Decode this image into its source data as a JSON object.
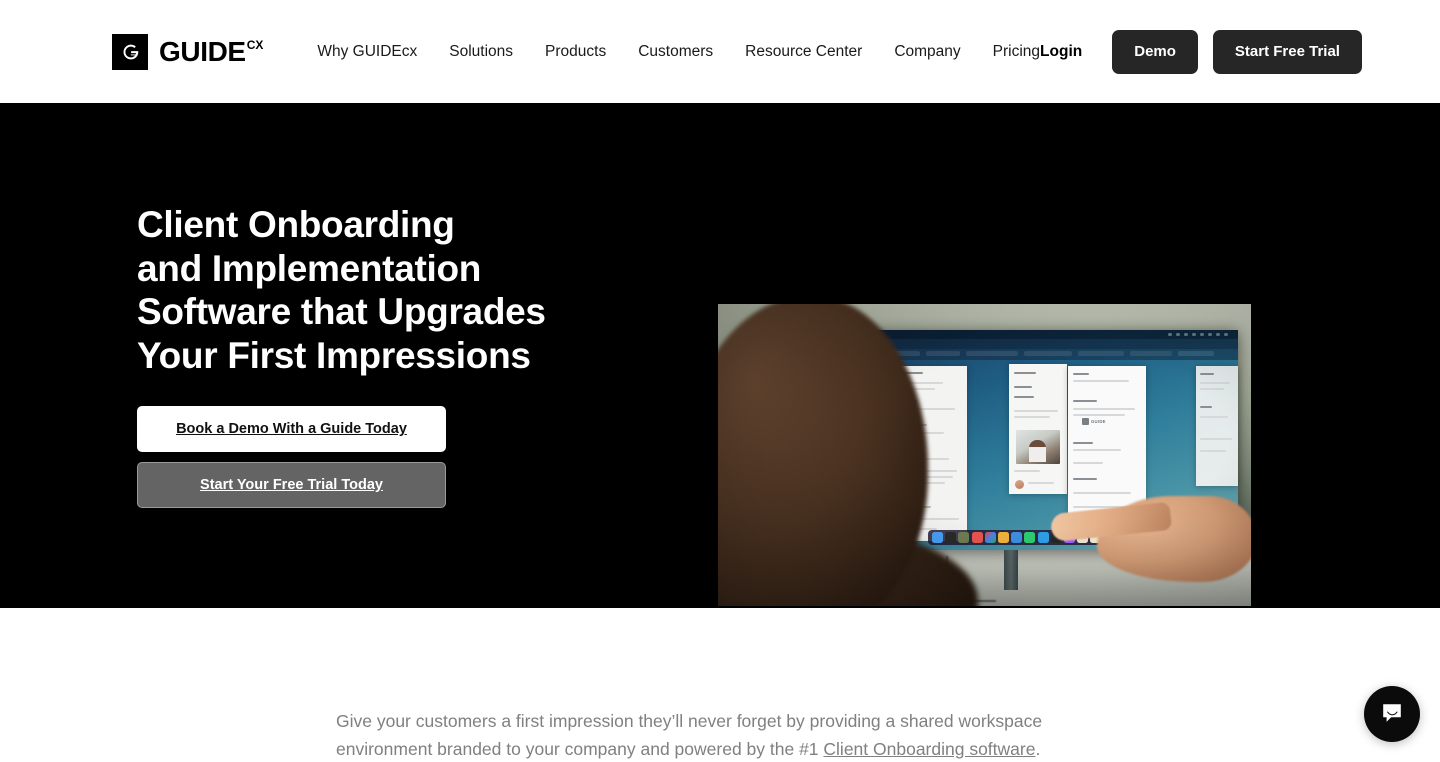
{
  "header": {
    "brand": {
      "mark_icon": "guidecx-g-logo-icon",
      "word": "GUIDE",
      "superscript": "CX"
    },
    "nav_items": [
      {
        "label": "Why GUIDEcx"
      },
      {
        "label": "Solutions"
      },
      {
        "label": "Products"
      },
      {
        "label": "Customers"
      },
      {
        "label": "Resource Center"
      },
      {
        "label": "Company"
      },
      {
        "label": "Pricing"
      }
    ],
    "login_label": "Login",
    "demo_label": "Demo",
    "trial_label": "Start Free Trial"
  },
  "hero": {
    "title_lines": [
      "Client Onboarding",
      "and Implementation",
      "Software that Upgrades",
      "Your First Impressions"
    ],
    "cta_primary": "Book a Demo With a Guide Today",
    "cta_secondary": "Start Your Free Trial Today",
    "media": {
      "alt": "Woman viewing a monitor while a hand points at a client onboarding workspace on screen",
      "screen_logo_text": "GUIDE"
    },
    "background_color": "#000000"
  },
  "lower": {
    "lead_part_1": "Give your customers a first impression they’ll never forget by providing a shared workspace environment branded to your company and powered by the #1 ",
    "lead_link": "Client Onboarding software",
    "lead_part_2": ".",
    "text_color": "#808080"
  },
  "chat": {
    "icon": "chat-bubble-smile-icon",
    "aria_label": "Open Intercom Messenger",
    "color": "#0b0b0b"
  },
  "theme": {
    "header_bg": "#ffffff",
    "hero_bg": "#000000",
    "button_dark": "#262626",
    "button_secondary_bg": "#646464",
    "button_secondary_border": "#9a9a9a",
    "text_dark": "#1a1a1a"
  }
}
